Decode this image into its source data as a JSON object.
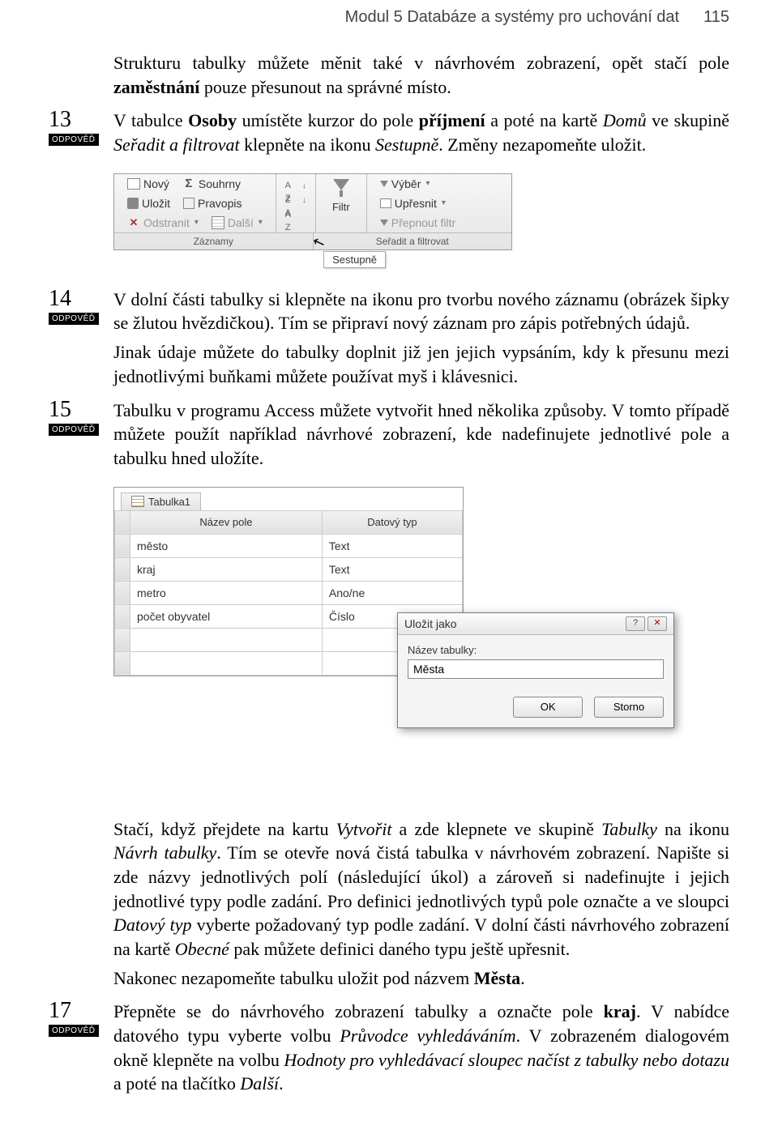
{
  "header": {
    "title": "Modul 5 Databáze a systémy pro uchování dat",
    "page": "115"
  },
  "intro": {
    "line1a": "Strukturu tabulky můžete měnit také v návrhovém zobrazení, opět stačí pole ",
    "line1b": "zaměstnání",
    "line1c": " pouze přesunout na správné místo."
  },
  "a13": {
    "num": "13",
    "tag": "ODPOVĚĎ",
    "t1": "V tabulce ",
    "t2": "Osoby",
    "t3": " umístěte kurzor do pole ",
    "t4": "příjmení",
    "t5": " a poté na kartě ",
    "t6": "Domů",
    "t7": " ve skupině ",
    "t8": "Seřadit a filtrovat",
    "t9": " klepněte na ikonu ",
    "t10": "Sestupně",
    "t11": ". Změny nezapomeňte uložit."
  },
  "ribbon": {
    "new": "Nový",
    "sum": "Souhrny",
    "save": "Uložit",
    "spell": "Pravopis",
    "delete": "Odstranit",
    "more": "Další",
    "records": "Záznamy",
    "filter": "Filtr",
    "select": "Výběr",
    "refine": "Upřesnit",
    "toggle": "Přepnout filtr",
    "sortfilter": "Seřadit a filtrovat",
    "tooltip": "Sestupně"
  },
  "a14": {
    "num": "14",
    "tag": "ODPOVĚĎ",
    "p1": "V dolní části tabulky si klepněte na ikonu pro tvorbu nového záznamu (obrázek šipky se žlutou hvězdičkou). Tím se připraví nový záznam pro zápis potřebných údajů.",
    "p2": "Jinak údaje můžete do tabulky doplnit již jen jejich vypsáním, kdy k přesunu mezi jednotlivými buňkami můžete používat myš i klávesnici."
  },
  "a15": {
    "num": "15",
    "tag": "ODPOVĚĎ",
    "p1": "Tabulku v programu Access můžete vytvořit hned několika způsoby. V tomto případě můžete použít například návrhové zobrazení, kde nadefinujete jednotlivé pole a tabulku hned uložíte."
  },
  "design": {
    "tab": "Tabulka1",
    "col1": "Název pole",
    "col2": "Datový typ",
    "rows": [
      {
        "name": "město",
        "type": "Text"
      },
      {
        "name": "kraj",
        "type": "Text"
      },
      {
        "name": "metro",
        "type": "Ano/ne"
      },
      {
        "name": "počet obyvatel",
        "type": "Číslo"
      }
    ]
  },
  "dialog": {
    "title": "Uložit jako",
    "label": "Název tabulky:",
    "value": "Města",
    "ok": "OK",
    "cancel": "Storno"
  },
  "after": {
    "p1a": "Stačí, když přejdete na kartu ",
    "p1b": "Vytvořit",
    "p1c": " a zde klepnete ve skupině ",
    "p1d": "Tabulky",
    "p1e": " na ikonu ",
    "p1f": "Návrh tabulky",
    "p1g": ". Tím se otevře nová čistá tabulka v návrhovém zobrazení. Napište si zde názvy jednotlivých polí (následující úkol) a zároveň si nadefinujte i jejich jednotlivé typy podle zadání. Pro definici jednotlivých typů pole označte a ve sloupci ",
    "p1h": "Datový typ",
    "p1i": " vyberte požadovaný typ podle zadání. V dolní části návrhového zobrazení na kartě ",
    "p1j": "Obecné",
    "p1k": " pak můžete definici daného typu ještě upřesnit.",
    "p2a": "Nakonec nezapomeňte tabulku uložit pod názvem ",
    "p2b": "Města",
    "p2c": "."
  },
  "a17": {
    "num": "17",
    "tag": "ODPOVĚĎ",
    "t1": "Přepněte se do návrhového zobrazení tabulky a označte pole ",
    "t2": "kraj",
    "t3": ". V nabídce datového typu vyberte volbu ",
    "t4": "Průvodce vyhledáváním",
    "t5": ". V zobrazeném dialogovém okně klepněte na volbu ",
    "t6": "Hodnoty pro vyhledávací sloupec načíst z tabulky nebo dotazu",
    "t7": " a poté na tlačítko ",
    "t8": "Další",
    "t9": "."
  }
}
